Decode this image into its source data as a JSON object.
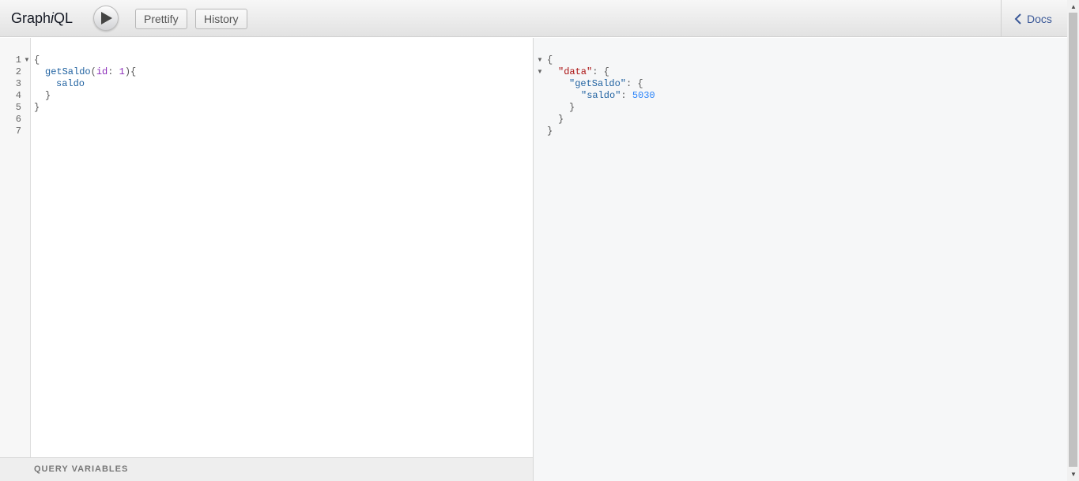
{
  "header": {
    "title_prefix": "Graph",
    "title_italic": "i",
    "title_suffix": "QL",
    "prettify_label": "Prettify",
    "history_label": "History",
    "docs_label": "Docs"
  },
  "query": {
    "line_numbers": [
      "1",
      "2",
      "3",
      "4",
      "5",
      "6",
      "7"
    ],
    "l1": "{",
    "l2_field": "getSaldo",
    "l2_paren_open": "(",
    "l2_arg": "id",
    "l2_colon": ": ",
    "l2_value": "1",
    "l2_paren_close": ")",
    "l2_brace": "{",
    "l3_field": "saldo",
    "l4": "}",
    "l5": "}"
  },
  "query_variables": {
    "label": "QUERY VARIABLES"
  },
  "result": {
    "l1": "{",
    "l2_key": "\"data\"",
    "l2_rest": ": {",
    "l3_key": "\"getSaldo\"",
    "l3_rest": ": {",
    "l4_key": "\"saldo\"",
    "l4_colon": ": ",
    "l4_value": "5030",
    "l5": "}",
    "l6": "}",
    "l7": "}"
  },
  "colors": {
    "field": "#1f61a0",
    "argument": "#8b2bb9",
    "number": "#2882f9",
    "json_key": "#aa1111",
    "docs_link": "#3b5998"
  }
}
